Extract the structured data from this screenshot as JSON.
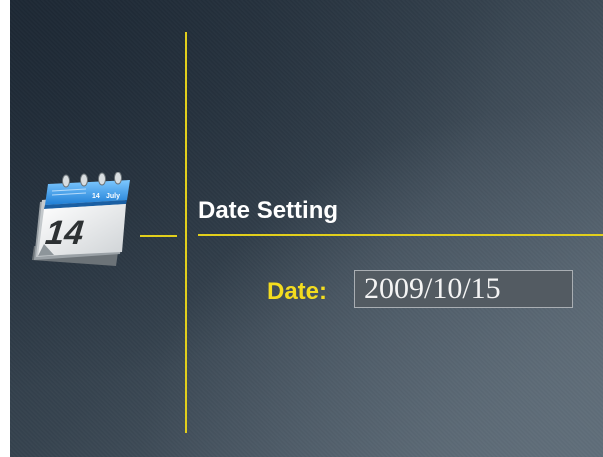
{
  "screen": {
    "title": "Date Setting",
    "date_label": "Date:",
    "date_value": "2009/10/15"
  },
  "calendar_icon": {
    "name": "calendar-icon",
    "day": "14",
    "month": "July"
  },
  "colors": {
    "accent_line": "#e2cf1c",
    "label_yellow": "#f3dc1f",
    "title_text": "#ffffff",
    "field_bg": "#535b62",
    "field_text": "#f4f4f4",
    "background": "#36434f"
  }
}
